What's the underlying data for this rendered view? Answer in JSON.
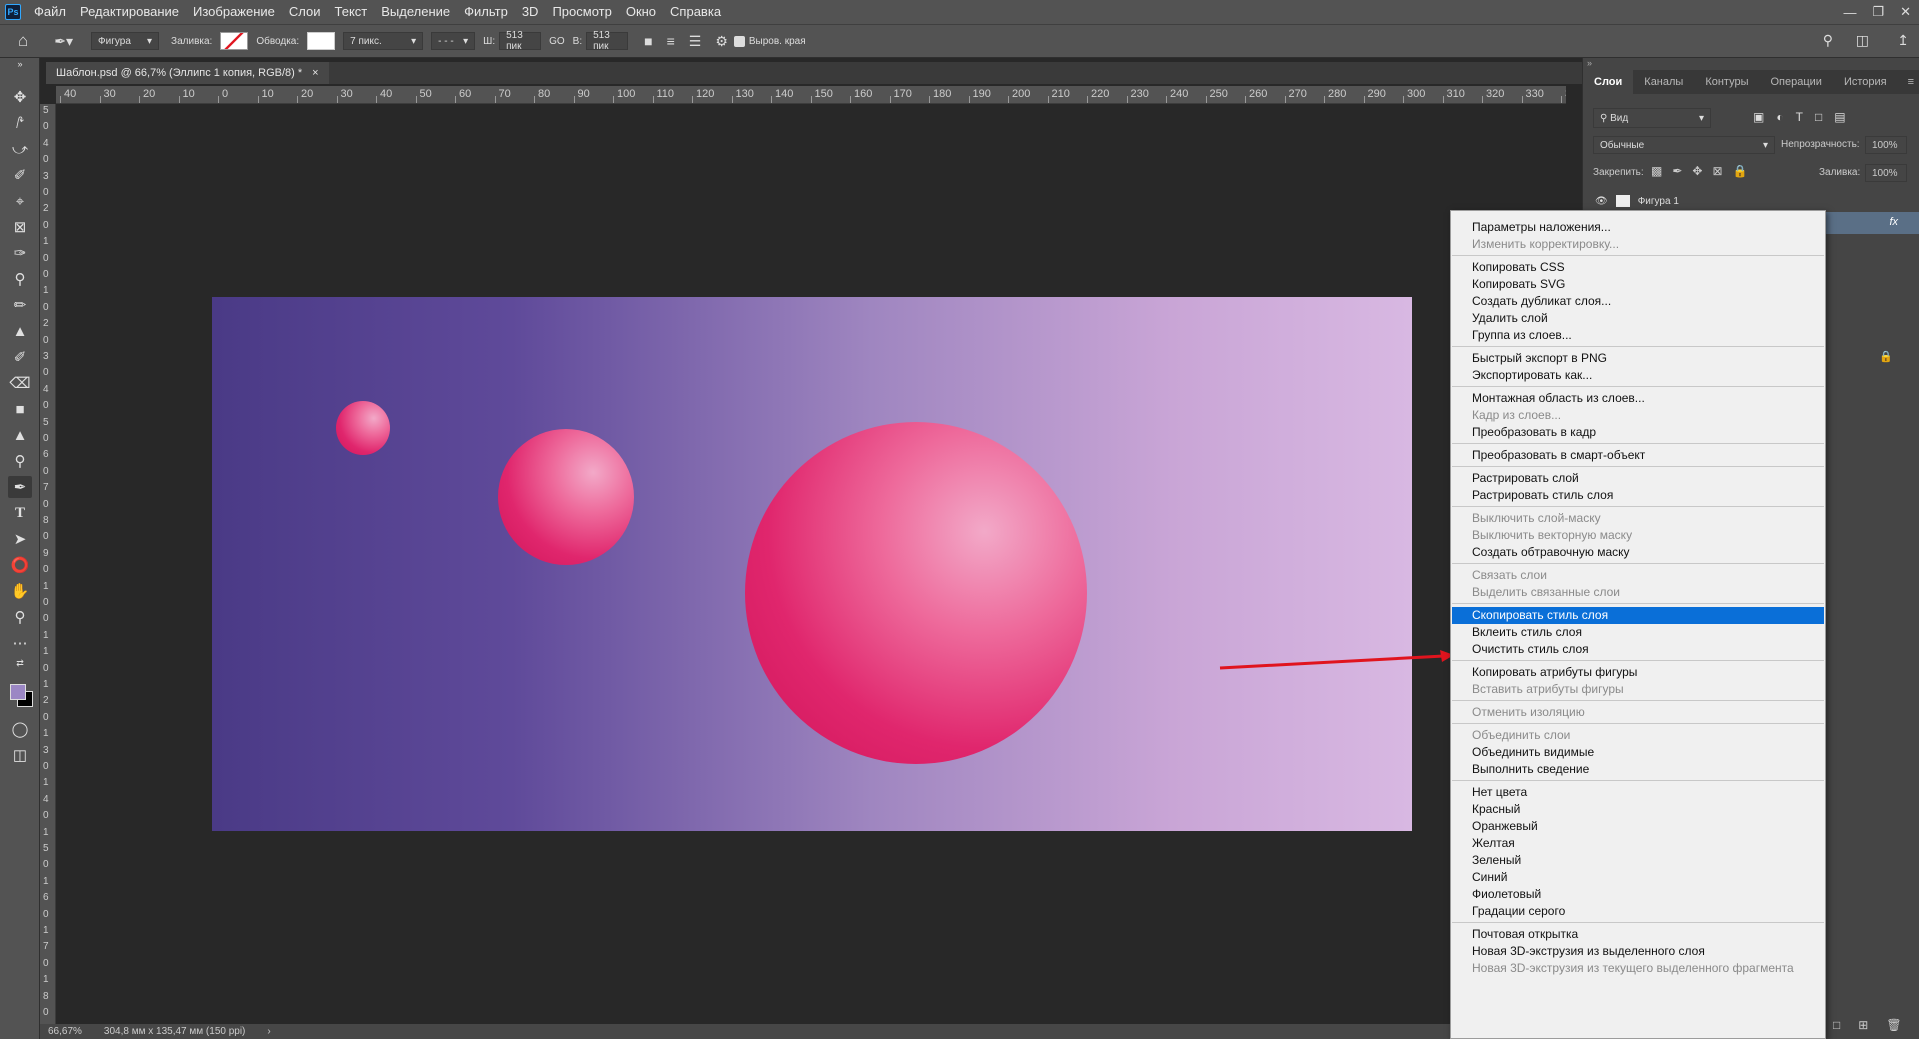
{
  "menubar": {
    "logo": "Ps",
    "items": [
      "Файл",
      "Редактирование",
      "Изображение",
      "Слои",
      "Текст",
      "Выделение",
      "Фильтр",
      "3D",
      "Просмотр",
      "Окно",
      "Справка"
    ]
  },
  "options": {
    "shape_mode": "Фигура",
    "fill_label": "Заливка:",
    "stroke_label": "Обводка:",
    "stroke_width": "7 пикс.",
    "w_label": "Ш:",
    "w_value": "513 пик",
    "link_label": "GO",
    "h_label": "В:",
    "h_value": "513 пик",
    "align_edges": "Выров. края"
  },
  "document": {
    "tab_title": "Шаблон.psd @ 66,7% (Эллипс 1 копия, RGB/8) *",
    "close": "×"
  },
  "ruler": {
    "top_ticks": [
      "40",
      "30",
      "20",
      "10",
      "0",
      "10",
      "20",
      "30",
      "40",
      "50",
      "60",
      "70",
      "80",
      "90",
      "100",
      "110",
      "120",
      "130",
      "140",
      "150",
      "160",
      "170",
      "180",
      "190",
      "200",
      "210",
      "220",
      "230",
      "240",
      "250",
      "260",
      "270",
      "280",
      "290",
      "300",
      "310",
      "320",
      "330",
      "34"
    ],
    "left_ticks": [
      "5",
      "0",
      "4",
      "0",
      "3",
      "0",
      "2",
      "0",
      "1",
      "0",
      "0",
      "1",
      "0",
      "2",
      "0",
      "3",
      "0",
      "4",
      "0",
      "5",
      "0",
      "6",
      "0",
      "7",
      "0",
      "8",
      "0",
      "9",
      "0",
      "1",
      "0",
      "0",
      "1",
      "1",
      "0",
      "1",
      "2",
      "0",
      "1",
      "3",
      "0",
      "1",
      "4",
      "0",
      "1",
      "5",
      "0",
      "1",
      "6",
      "0",
      "1",
      "7",
      "0",
      "1",
      "8",
      "0"
    ]
  },
  "status": {
    "zoom": "66,67%",
    "doc_size": "304,8 мм x 135,47 мм (150 ppi)",
    "chevron": "›"
  },
  "layers_panel": {
    "tabs": [
      "Слои",
      "Каналы",
      "Контуры",
      "Операции",
      "История"
    ],
    "filter": "Вид",
    "blend_mode": "Обычные",
    "opacity_label": "Непрозрачность:",
    "opacity_value": "100%",
    "lock_label": "Закрепить:",
    "fill_label": "Заливка:",
    "fill_value": "100%",
    "layer_name": "Фигура 1",
    "fx": "fx"
  },
  "context_menu": [
    {
      "label": "Параметры наложения...",
      "enabled": true
    },
    {
      "label": "Изменить корректировку...",
      "enabled": false
    },
    {
      "sep": true
    },
    {
      "label": "Копировать CSS",
      "enabled": true
    },
    {
      "label": "Копировать SVG",
      "enabled": true
    },
    {
      "label": "Создать дубликат слоя...",
      "enabled": true
    },
    {
      "label": "Удалить слой",
      "enabled": true
    },
    {
      "label": "Группа из слоев...",
      "enabled": true
    },
    {
      "sep": true
    },
    {
      "label": "Быстрый экспорт в PNG",
      "enabled": true
    },
    {
      "label": "Экспортировать как...",
      "enabled": true
    },
    {
      "sep": true
    },
    {
      "label": "Монтажная область из слоев...",
      "enabled": true
    },
    {
      "label": "Кадр из слоев...",
      "enabled": false
    },
    {
      "label": "Преобразовать в кадр",
      "enabled": true
    },
    {
      "sep": true
    },
    {
      "label": "Преобразовать в смарт-объект",
      "enabled": true
    },
    {
      "sep": true
    },
    {
      "label": "Растрировать слой",
      "enabled": true
    },
    {
      "label": "Растрировать стиль слоя",
      "enabled": true
    },
    {
      "sep": true
    },
    {
      "label": "Выключить слой-маску",
      "enabled": false
    },
    {
      "label": "Выключить векторную маску",
      "enabled": false
    },
    {
      "label": "Создать обтравочную маску",
      "enabled": true
    },
    {
      "sep": true
    },
    {
      "label": "Связать слои",
      "enabled": false
    },
    {
      "label": "Выделить связанные слои",
      "enabled": false
    },
    {
      "sep": true
    },
    {
      "label": "Скопировать стиль слоя",
      "enabled": true,
      "highlighted": true
    },
    {
      "label": "Вклеить стиль слоя",
      "enabled": true
    },
    {
      "label": "Очистить стиль слоя",
      "enabled": true
    },
    {
      "sep": true
    },
    {
      "label": "Копировать атрибуты фигуры",
      "enabled": true
    },
    {
      "label": "Вставить атрибуты фигуры",
      "enabled": false
    },
    {
      "sep": true
    },
    {
      "label": "Отменить изоляцию",
      "enabled": false
    },
    {
      "sep": true
    },
    {
      "label": "Объединить слои",
      "enabled": false
    },
    {
      "label": "Объединить видимые",
      "enabled": true
    },
    {
      "label": "Выполнить сведение",
      "enabled": true
    },
    {
      "sep": true
    },
    {
      "label": "Нет цвета",
      "enabled": true
    },
    {
      "label": "Красный",
      "enabled": true
    },
    {
      "label": "Оранжевый",
      "enabled": true
    },
    {
      "label": "Желтая",
      "enabled": true
    },
    {
      "label": "Зеленый",
      "enabled": true
    },
    {
      "label": "Синий",
      "enabled": true
    },
    {
      "label": "Фиолетовый",
      "enabled": true
    },
    {
      "label": "Градации серого",
      "enabled": true
    },
    {
      "sep": true
    },
    {
      "label": "Почтовая открытка",
      "enabled": true
    },
    {
      "label": "Новая 3D-экструзия из выделенного слоя",
      "enabled": true
    },
    {
      "label": "Новая 3D-экструзия из текущего выделенного фрагмента",
      "enabled": false
    }
  ],
  "colors": {
    "highlight": "#0a6fd8",
    "arrow": "#e0141e",
    "foreground": "#9b87c4",
    "background": "#000000"
  }
}
